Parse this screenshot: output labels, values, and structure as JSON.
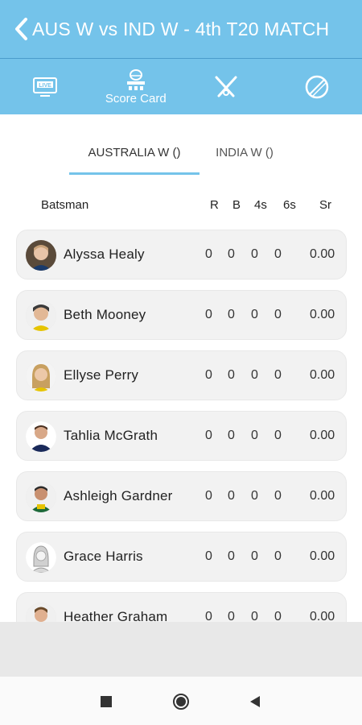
{
  "header": {
    "title": "AUS W vs IND W - 4th T20 MATCH",
    "back_icon": "chevron-left-icon"
  },
  "toolbar": {
    "items": [
      {
        "icon": "live-tv-icon",
        "label": ""
      },
      {
        "icon": "scoreboard-icon",
        "label": "Score Card"
      },
      {
        "icon": "crossed-bats-icon",
        "label": ""
      },
      {
        "icon": "cricket-ball-icon",
        "label": ""
      }
    ]
  },
  "tabs": [
    {
      "label": "AUSTRALIA W ()",
      "selected": true
    },
    {
      "label": "INDIA W ()",
      "selected": false
    }
  ],
  "columns": {
    "batsman": "Batsman",
    "r": "R",
    "b": "B",
    "fours": "4s",
    "sixes": "6s",
    "sr": "Sr"
  },
  "players": [
    {
      "name": "Alyssa Healy",
      "r": "0",
      "b": "0",
      "fours": "0",
      "sixes": "0",
      "sr": "0.00"
    },
    {
      "name": "Beth Mooney",
      "r": "0",
      "b": "0",
      "fours": "0",
      "sixes": "0",
      "sr": "0.00"
    },
    {
      "name": "Ellyse Perry",
      "r": "0",
      "b": "0",
      "fours": "0",
      "sixes": "0",
      "sr": "0.00"
    },
    {
      "name": "Tahlia McGrath",
      "r": "0",
      "b": "0",
      "fours": "0",
      "sixes": "0",
      "sr": "0.00"
    },
    {
      "name": "Ashleigh Gardner",
      "r": "0",
      "b": "0",
      "fours": "0",
      "sixes": "0",
      "sr": "0.00"
    },
    {
      "name": "Grace Harris",
      "r": "0",
      "b": "0",
      "fours": "0",
      "sixes": "0",
      "sr": "0.00"
    },
    {
      "name": "Heather Graham",
      "r": "0",
      "b": "0",
      "fours": "0",
      "sixes": "0",
      "sr": "0.00"
    }
  ],
  "colors": {
    "accent": "#74c3ea",
    "row_bg": "#f2f2f2"
  },
  "system_nav": [
    "recents-square-icon",
    "home-circle-icon",
    "back-triangle-icon"
  ]
}
